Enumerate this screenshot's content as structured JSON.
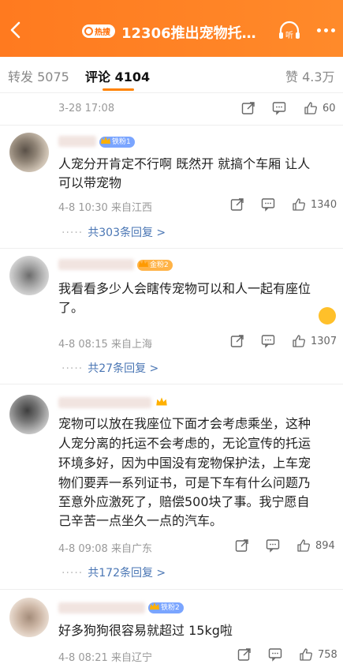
{
  "header": {
    "hot_label": "热搜",
    "title": "12306推出宠物托…",
    "listen_label": "听"
  },
  "tabs": {
    "repost": "转发 5075",
    "comments": "评论 4104",
    "likes": "赞 4.3万"
  },
  "comments": [
    {
      "time_loc": "3-28 17:08",
      "likes": "60"
    },
    {
      "badge": "铁粉1",
      "text": [
        "人宠分开肯定不行啊 既然开 就搞个车厢 让人",
        "可以带宠物"
      ],
      "time_loc": "4-8 10:30 来自江西",
      "likes": "1340",
      "replies": "共303条回复 >"
    },
    {
      "badge": "金粉2",
      "text": [
        "我看看多少人会瞎传宠物可以和人一起有座位",
        "了。"
      ],
      "time_loc": "4-8 08:15 来自上海",
      "likes": "1307",
      "replies": "共27条回复 >"
    },
    {
      "text": [
        "宠物可以放在我座位下面才会考虑乘坐，这种",
        "人宠分离的托运不会考虑的，无论宣传的托运",
        "环境多好，因为中国没有宠物保护法，上车宠",
        "物们要弄一系列证书，可是下车有什么问题乃",
        "至意外应激死了，赔偿500块了事。我宁愿自",
        "己辛苦一点坐久一点的汽车。"
      ],
      "time_loc": "4-8 09:08 来自广东",
      "likes": "894",
      "replies": "共172条回复 >"
    },
    {
      "badge": "铁粉2",
      "text": [
        "好多狗狗很容易就超过 15kg啦"
      ],
      "time_loc": "4-8 08:21 来自辽宁",
      "likes": "758"
    }
  ],
  "colors": {
    "accent": "#ff7a1f",
    "link": "#4a76b4"
  }
}
